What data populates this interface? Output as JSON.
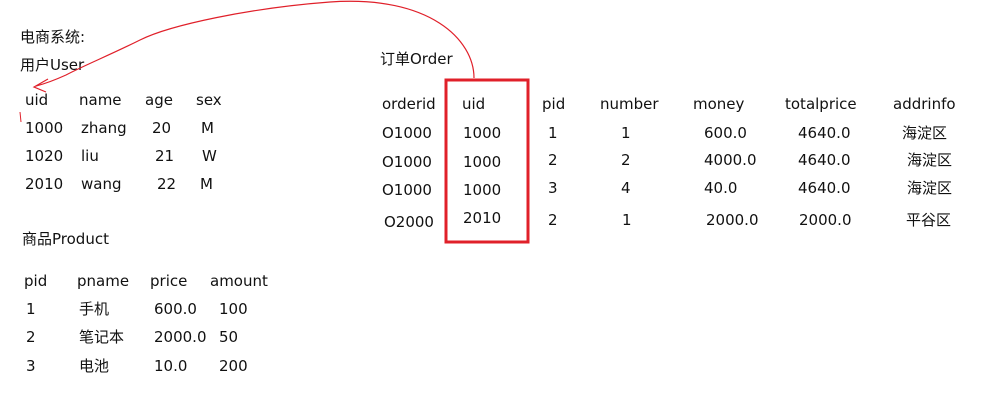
{
  "system_title": "电商系统:",
  "user_table": {
    "title": "用户User",
    "headers": [
      "uid",
      "name",
      "age",
      "sex"
    ],
    "rows": [
      [
        "1000",
        "zhang",
        "20",
        "M"
      ],
      [
        "1020",
        "liu",
        "21",
        "W"
      ],
      [
        "2010",
        "wang",
        "22",
        "M"
      ]
    ]
  },
  "product_table": {
    "title": "商品Product",
    "headers": [
      "pid",
      "pname",
      "price",
      "amount"
    ],
    "rows": [
      [
        "1",
        "手机",
        "600.0",
        "100"
      ],
      [
        "2",
        "笔记本",
        "2000.0",
        "50"
      ],
      [
        "3",
        "电池",
        "10.0",
        "200"
      ]
    ]
  },
  "order_table": {
    "title": "订单Order",
    "headers": [
      "orderid",
      "uid",
      "pid",
      "number",
      "money",
      "totalprice",
      "addrinfo"
    ],
    "rows": [
      [
        "O1000",
        "1000",
        "1",
        "1",
        "600.0",
        "4640.0",
        "海淀区"
      ],
      [
        "O1000",
        "1000",
        "2",
        "2",
        "4000.0",
        "4640.0",
        "海淀区"
      ],
      [
        "O1000",
        "1000",
        "3",
        "4",
        "40.0",
        "4640.0",
        "海淀区"
      ],
      [
        "O2000",
        "2010",
        "2",
        "1",
        "2000.0",
        "2000.0",
        "平谷区"
      ]
    ]
  },
  "colors": {
    "highlight": "#e0202a",
    "text": "#111111"
  }
}
